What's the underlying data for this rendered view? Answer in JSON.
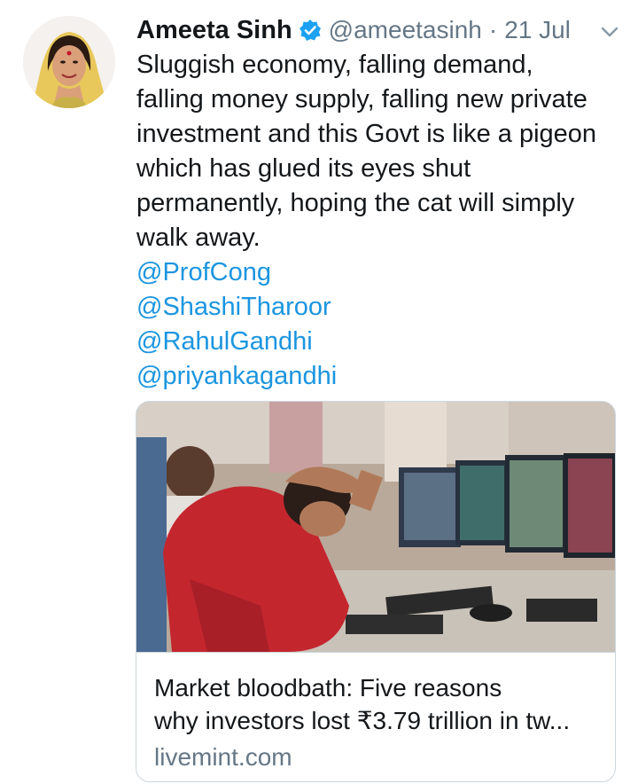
{
  "tweet": {
    "author": {
      "display_name": "Ameeta Sinh",
      "handle": "@ameetasinh",
      "verified": true
    },
    "separator": "·",
    "date": "21 Jul",
    "text_lines": [
      "Sluggish economy, falling demand,",
      "falling money supply, falling new private",
      "investment and this Govt is like a pigeon",
      "which has glued its eyes shut",
      "permanently, hoping the cat will simply",
      "walk away."
    ],
    "mentions": [
      "@ProfCong",
      "@ShashiTharoor",
      "@RahulGandhi",
      "@priyankagandhi"
    ],
    "card": {
      "title_lines": [
        "Market bloodbath: Five reasons",
        "why investors lost ₹3.79 trillion in tw..."
      ],
      "domain": "livemint.com"
    }
  },
  "icons": {
    "verified": "verified-badge-icon",
    "caret": "chevron-down-icon"
  },
  "colors": {
    "link": "#1b95e0",
    "secondary_text": "#657786",
    "verified": "#1da1f2"
  }
}
